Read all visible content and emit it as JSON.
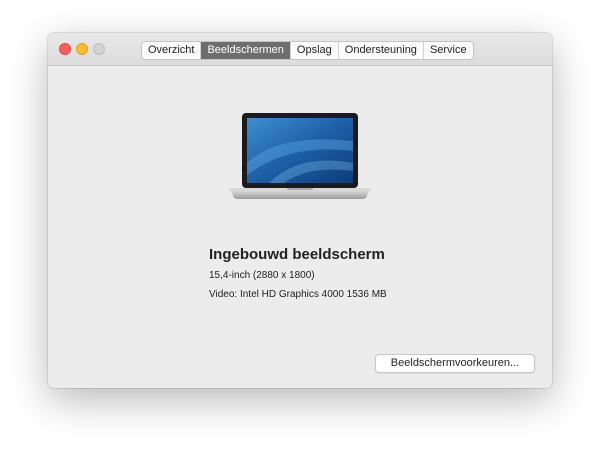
{
  "window": {
    "tabs": [
      {
        "label": "Overzicht",
        "active": false
      },
      {
        "label": "Beeldschermen",
        "active": true
      },
      {
        "label": "Opslag",
        "active": false
      },
      {
        "label": "Ondersteuning",
        "active": false
      },
      {
        "label": "Service",
        "active": false
      }
    ],
    "traffic_lights": [
      "close-icon",
      "minimize-icon",
      "zoom-icon"
    ]
  },
  "display": {
    "title": "Ingebouwd beeldscherm",
    "size": "15,4-inch (2880 x 1800)",
    "video": "Video: Intel HD Graphics 4000 1536 MB",
    "image_icon": "laptop-icon"
  },
  "buttons": {
    "preferences": "Beeldschermvoorkeuren..."
  },
  "colors": {
    "active_tab": "#6e6e6e",
    "close": "#ff5f57",
    "minimize": "#febc2e",
    "zoom_disabled": "#d2d2d2",
    "window_bg": "#ececec"
  }
}
